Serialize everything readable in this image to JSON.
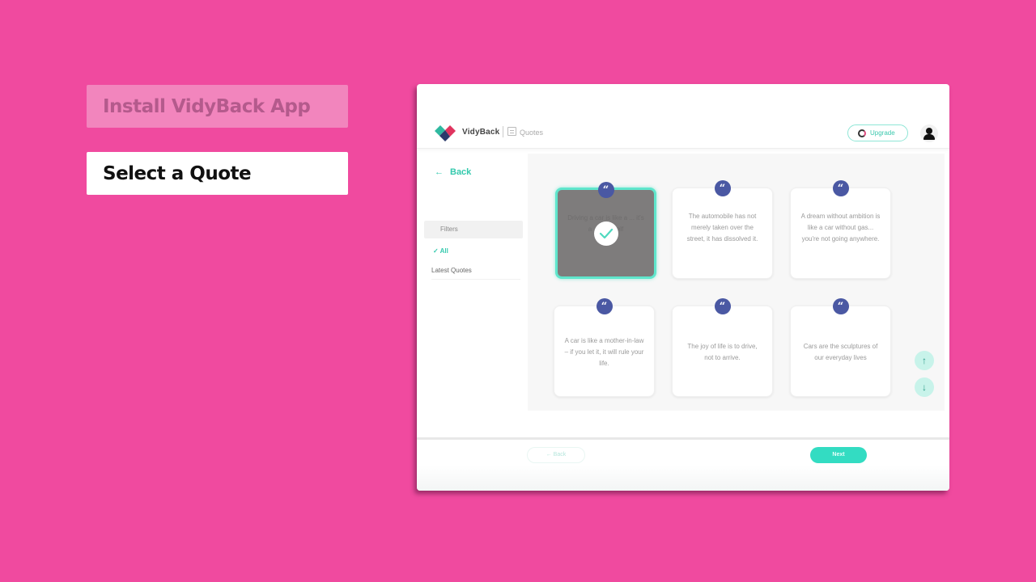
{
  "steps": [
    {
      "label": "Install VidyBack App",
      "state": "completed"
    },
    {
      "label": "Select a Quote",
      "state": "active"
    }
  ],
  "app": {
    "brand": "VidyBack",
    "breadcrumb": "Quotes",
    "upgrade_label": "Upgrade",
    "accent_color": "#33c9ad",
    "badge_color": "#4a58a3"
  },
  "sidebar": {
    "back_label": "Back",
    "filters_heading": "Filters",
    "filters": [
      {
        "label": "All",
        "selected": true
      },
      {
        "label": "Latest Quotes",
        "selected": false
      }
    ]
  },
  "quotes": [
    {
      "text": "Driving a car is like a ... it's a ... yourself",
      "selected": true
    },
    {
      "text": "The automobile has not merely taken over the street, it has dissolved it.",
      "selected": false
    },
    {
      "text": "A dream without ambition is like a car without gas... you're not going anywhere.",
      "selected": false
    },
    {
      "text": "A car is like a mother-in-law – if you let it, it will rule your life.",
      "selected": false
    },
    {
      "text": "The joy of life is to drive, not to arrive.",
      "selected": false
    },
    {
      "text": "Cars are the sculptures of our everyday lives",
      "selected": false
    }
  ],
  "quote_glyph": "“",
  "scroll": {
    "up": "↑",
    "down": "↓"
  },
  "footer": {
    "back_label": "← Back",
    "next_label": "Next"
  }
}
